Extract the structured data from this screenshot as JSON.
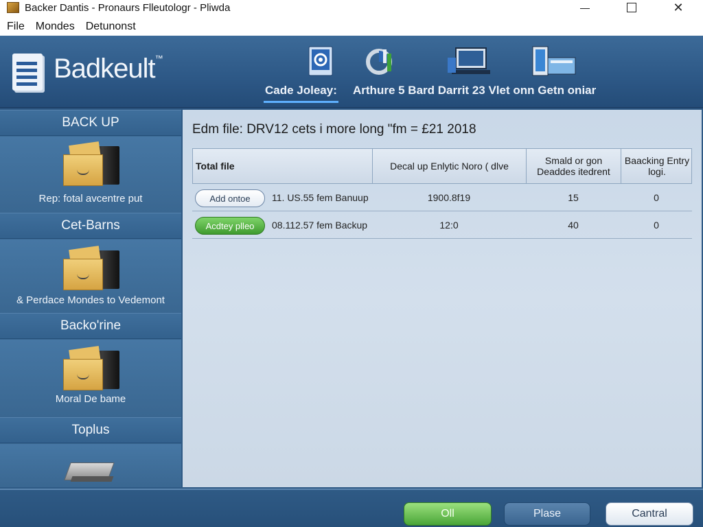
{
  "window": {
    "title": "Backer Dantis - Pronaurs Flleutologr - Pliwda",
    "minimize_icon": "minimize-icon",
    "maximize_icon": "maximize-icon",
    "close_icon": "close-icon"
  },
  "menu": {
    "items": [
      "File",
      "Mondes",
      "Detunonst"
    ]
  },
  "header": {
    "brand": "Badkeult",
    "brand_mark": "™",
    "active_tab": "Cade Joleay:",
    "tabs_text": "Arthure 5 Bard Darrit 23 Vlet onn Getn oniar",
    "tool_icons": [
      "gear-document-icon",
      "chart-tool-icon",
      "computer-icon",
      "device-icon"
    ]
  },
  "sidebar": {
    "sections": [
      {
        "heading": "BACK UP",
        "caption": "Rep: fotal avcentre put",
        "icon": "folder-icon"
      },
      {
        "heading": "Cet-Barns",
        "caption": "& Perdace Mondes to Vedemont",
        "icon": "folder-icon"
      },
      {
        "heading": "Backo'rine",
        "caption": "Moral De bame",
        "icon": "folder-icon"
      },
      {
        "heading": "Toplus",
        "caption": "",
        "icon": "drive-icon"
      }
    ]
  },
  "main": {
    "title": "Edm file: DRV12 cets i more long \"fm = £21 2018",
    "columns": [
      "Total file",
      "Decal up Enlytic Noro ( dlve",
      "Smald or gon Deaddes itedrent",
      "Baacking Entry logi."
    ],
    "rows": [
      {
        "button": "Add ontoe",
        "button_style": "white",
        "name": "11. US.55 fem Banuup",
        "size": "1900.8f19",
        "files": "15",
        "entry": "0"
      },
      {
        "button": "Acdtey plleo",
        "button_style": "green",
        "name": "08.112.57 fem Backup",
        "size": "12:0",
        "files": "40",
        "entry": "0"
      }
    ]
  },
  "footer": {
    "ok": "Oll",
    "place": "Plase",
    "central": "Cantral"
  },
  "colors": {
    "accent": "#2f5a85",
    "green": "#4aa638",
    "panel": "#cbd8e6"
  }
}
